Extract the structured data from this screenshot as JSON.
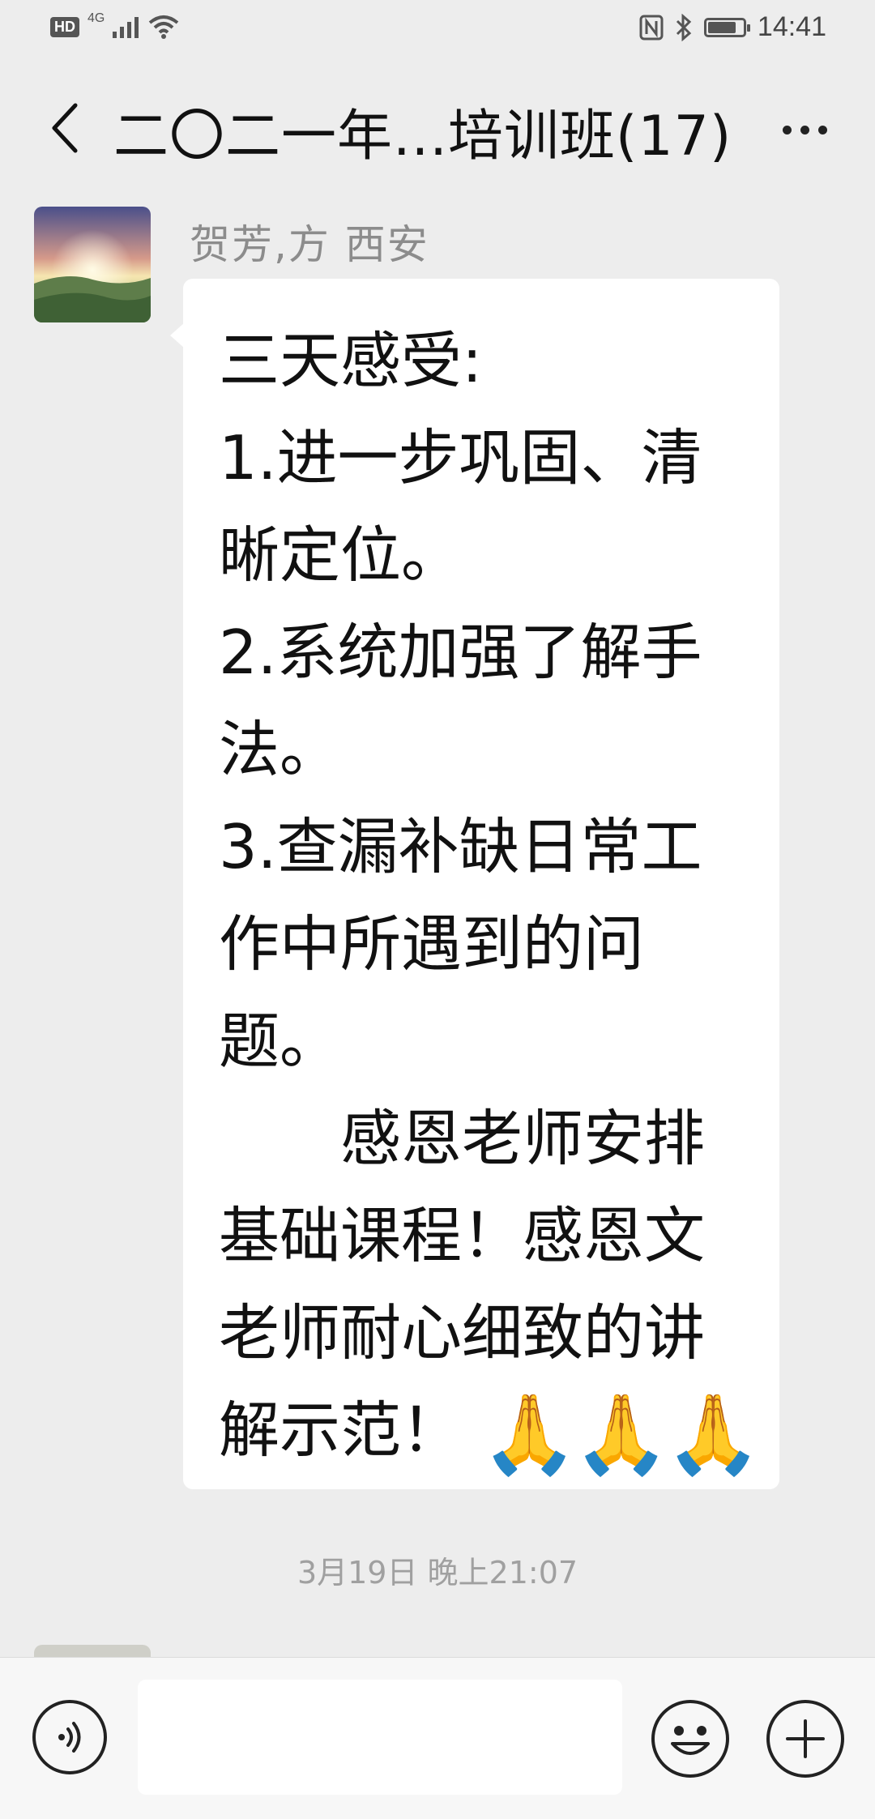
{
  "status_bar": {
    "hd_label": "HD",
    "network_label": "4G",
    "time": "14:41",
    "battery_level": 0.82
  },
  "header": {
    "title": "二〇二一年...培训班(17)"
  },
  "message": {
    "sender": "贺芳,方  西安",
    "lines": [
      "三天感受:",
      "1.进一步巩固、清",
      "晰定位。",
      "2.系统加强了解手",
      "法。",
      "3.查漏补缺日常工",
      "作中所遇到的问",
      "题。",
      "　　感恩老师安排",
      "基础课程！感恩文",
      "老师耐心细致的讲",
      "解示范！"
    ],
    "emoji": "🙏🙏🙏"
  },
  "timestamp": "3月19日 晚上21:07",
  "input_bar": {
    "text_value": ""
  },
  "icons": {
    "back": "chevron-left-icon",
    "more": "more-dots-icon",
    "voice": "voice-icon",
    "emoji": "smiley-icon",
    "plus": "plus-icon"
  }
}
